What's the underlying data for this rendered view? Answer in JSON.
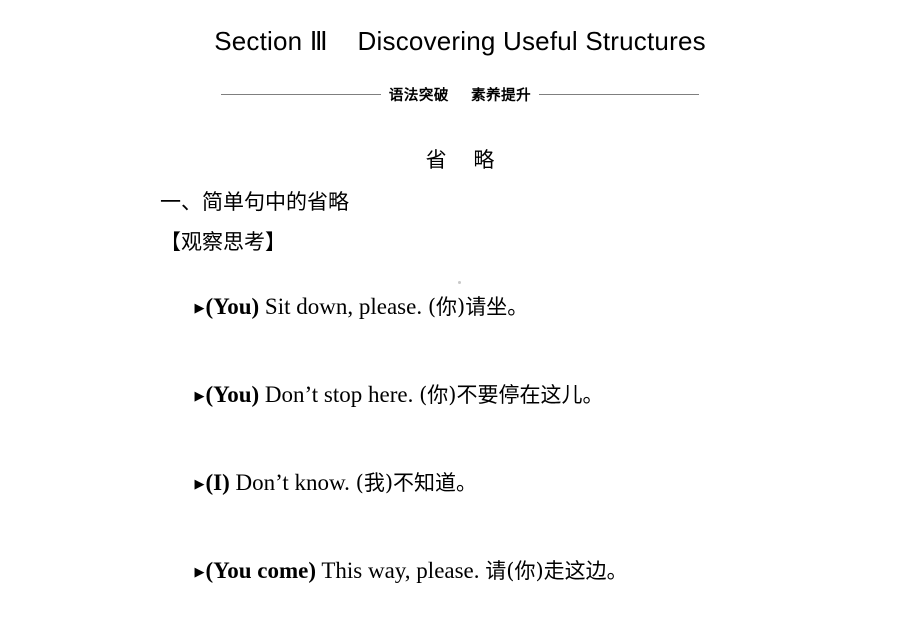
{
  "slide": {
    "title": "Section Ⅲ    Discovering Useful Structures",
    "subtitle": "语法突破    素养提升",
    "topic_heading": "省    略",
    "section_heading": "一、简单句中的省略",
    "observe_label": "【观察思考】",
    "examples": [
      {
        "marker": "▶",
        "omitted": "(You)",
        "english": " Sit down, please. ",
        "chinese": "(你)请坐。"
      },
      {
        "marker": "▶",
        "omitted": "(You)",
        "english": " Don’t stop here. ",
        "chinese": "(你)不要停在这儿。"
      },
      {
        "marker": "▶",
        "omitted": "(I)",
        "english": " Don’t know. ",
        "chinese": "(我)不知道。"
      },
      {
        "marker": "▶",
        "omitted": "(You come)",
        "english": " This way, please. ",
        "chinese": "请(你)走这边。"
      }
    ]
  }
}
